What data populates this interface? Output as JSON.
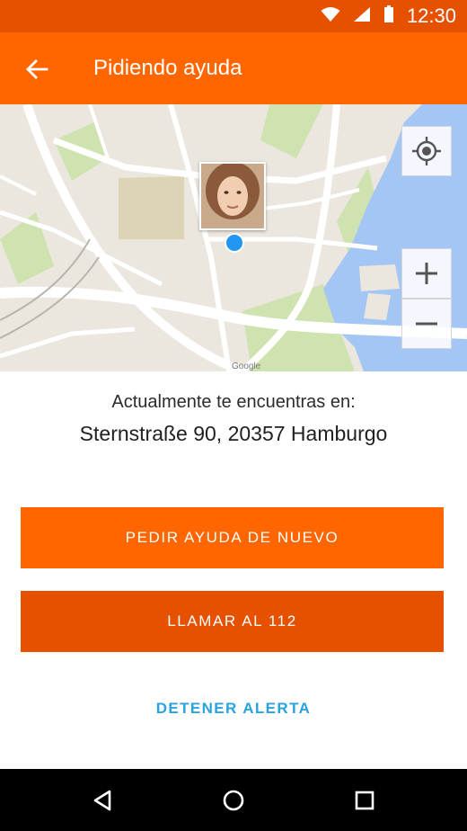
{
  "status_bar": {
    "time": "12:30",
    "icons": [
      "wifi-icon",
      "signal-icon",
      "battery-icon"
    ]
  },
  "app_bar": {
    "title": "Pidiendo ayuda",
    "back_icon": "arrow-back-icon"
  },
  "map": {
    "attribution": "Google",
    "controls": [
      "my-location-icon",
      "zoom-in-icon",
      "zoom-out-icon"
    ]
  },
  "location": {
    "label": "Actualmente te encuentras en:",
    "address": "Sternstraße 90, 20357 Hamburgo"
  },
  "actions": {
    "ask_again": "PEDIR AYUDA DE NUEVO",
    "call": "LLAMAR AL 112",
    "stop": "DETENER ALERTA"
  },
  "nav_bar": {
    "icons": [
      "back-triangle-icon",
      "home-circle-icon",
      "recents-square-icon"
    ]
  },
  "colors": {
    "primary": "#ff6600",
    "primary_dark": "#e65100",
    "link": "#29a3e0",
    "water": "#a4c6f5"
  }
}
